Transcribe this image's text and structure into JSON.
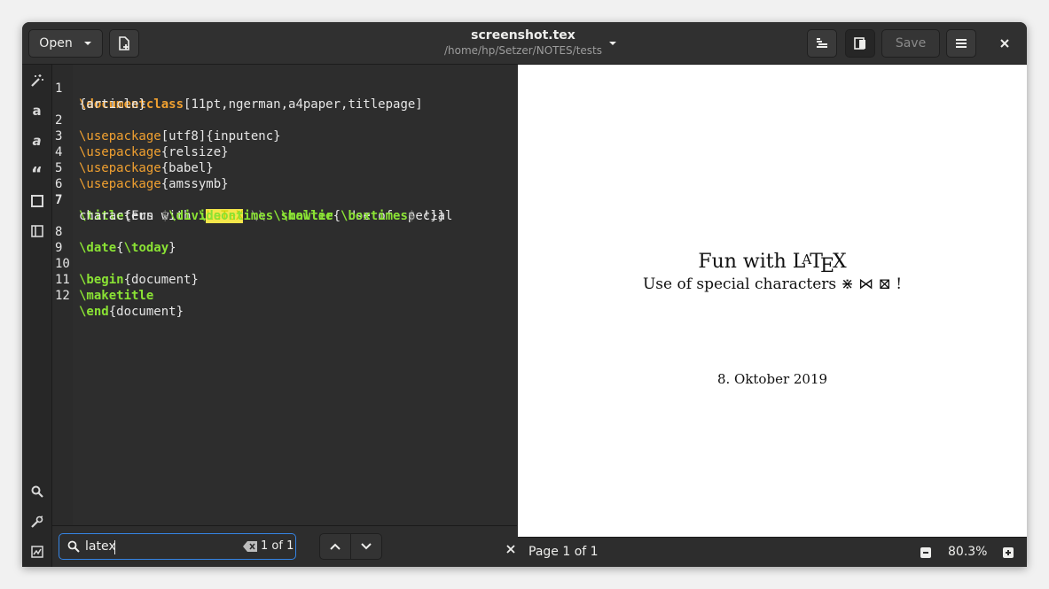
{
  "header": {
    "open_label": "Open",
    "title": "screenshot.tex",
    "subtitle": "/home/hp/Setzer/NOTES/tests",
    "save_label": "Save"
  },
  "editor": {
    "lines": [
      {
        "num": "1"
      },
      {
        "num": "2"
      },
      {
        "num": "3"
      },
      {
        "num": "4"
      },
      {
        "num": "5"
      },
      {
        "num": "6"
      },
      {
        "num": "7"
      },
      {
        "num": "8"
      },
      {
        "num": "9"
      },
      {
        "num": "10"
      },
      {
        "num": "11"
      },
      {
        "num": "12"
      }
    ],
    "tokens": {
      "documentclass": "\\documentclass",
      "dc_args": "[11pt,ngerman,a4paper,titlepage]",
      "dc_wrap": "{article}",
      "usepackage": "\\usepackage",
      "utf8": "[utf8]{inputenc}",
      "relsize": "{relsize}",
      "babel": "{babel}",
      "amssymb": "{amssymb}",
      "title": "\\title",
      "fun_with": "{Fun with ",
      "bs": "\\",
      "latex": "LaTeX",
      "newline": " \\\\ ",
      "smaller": "\\smaller",
      "use_of": "{ Use of special",
      "characters": "characters ",
      "dollar": "$",
      "divideontimes": "\\divideontimes",
      "bowtie": " \\bowtie",
      "boxtimes": " \\boxtimes",
      "dollar2": "$",
      "close": " !}}",
      "date": "\\date",
      "brace_open": "{",
      "today": "\\today",
      "brace_close": "}",
      "begin": "\\begin",
      "document_arg": "{document}",
      "maketitle": "\\maketitle",
      "end": "\\end",
      "document_arg2": "{document}"
    }
  },
  "search": {
    "query": "latex",
    "count": "1 of 1"
  },
  "preview": {
    "title_prefix": "Fun with ",
    "latex_L": "L",
    "latex_A": "A",
    "latex_T": "T",
    "latex_E": "E",
    "latex_X": "X",
    "subtitle": "Use of special characters ⋇ ⋈ ⊠ !",
    "date": "8. Oktober 2019"
  },
  "status": {
    "page": "Page 1 of 1",
    "zoom": "80.3%"
  }
}
